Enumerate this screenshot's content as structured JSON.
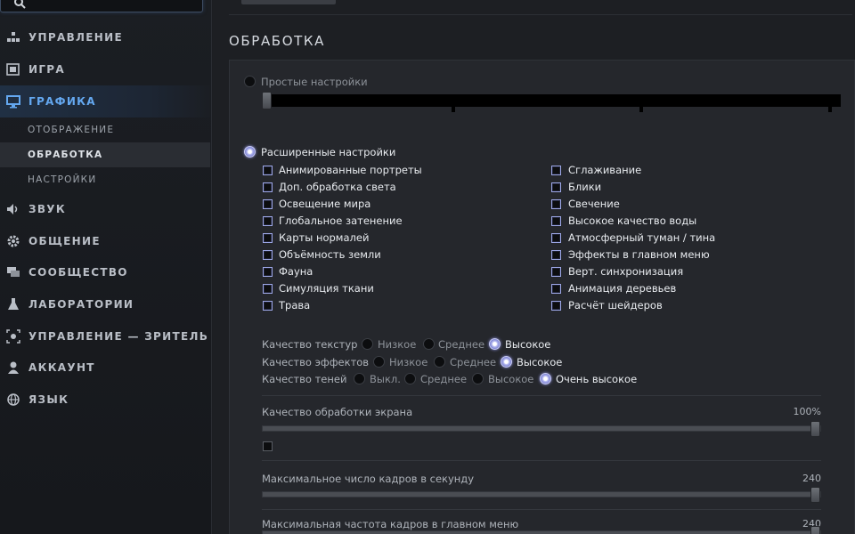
{
  "search": {
    "placeholder": ""
  },
  "sidebar": {
    "items": [
      {
        "label": "УПРАВЛЕНИЕ",
        "icon": "controls-icon"
      },
      {
        "label": "ИГРА",
        "icon": "game-icon"
      },
      {
        "label": "ГРАФИКА",
        "icon": "monitor-icon"
      },
      {
        "label": "ЗВУК",
        "icon": "speaker-icon"
      },
      {
        "label": "ОБЩЕНИЕ",
        "icon": "gear-icon"
      },
      {
        "label": "СООБЩЕСТВО",
        "icon": "chat-icon"
      },
      {
        "label": "ЛАБОРАТОРИИ",
        "icon": "flask-icon"
      },
      {
        "label": "УПРАВЛЕНИЕ — ЗРИТЕЛЬ",
        "icon": "spectator-icon"
      },
      {
        "label": "АККАУНТ",
        "icon": "user-icon"
      },
      {
        "label": "ЯЗЫК",
        "icon": "globe-icon"
      }
    ],
    "graphics_sub": [
      "ОТОБРАЖЕНИЕ",
      "ОБРАБОТКА",
      "НАСТРОЙКИ"
    ],
    "active_item": "ГРАФИКА",
    "active_sub": "ОБРАБОТКА"
  },
  "main": {
    "section_title": "ОБРАБОТКА",
    "simple_label": "Простые настройки",
    "advanced_label": "Расширенные настройки",
    "checkboxes_left": [
      "Анимированные портреты",
      "Доп. обработка света",
      "Освещение мира",
      "Глобальное затенение",
      "Карты нормалей",
      "Объёмность земли",
      "Фауна",
      "Симуляция ткани",
      "Трава"
    ],
    "checkboxes_right": [
      "Сглаживание",
      "Блики",
      "Свечение",
      "Высокое качество воды",
      "Атмосферный туман / тина",
      "Эффекты в главном меню",
      "Верт. синхронизация",
      "Анимация деревьев",
      "Расчёт шейдеров"
    ],
    "texture_quality": {
      "label": "Качество текстур",
      "options": [
        "Низкое",
        "Среднее",
        "Высокое"
      ],
      "selected": "Высокое"
    },
    "effects_quality": {
      "label": "Качество эффектов",
      "options": [
        "Низкое",
        "Среднее",
        "Высокое"
      ],
      "selected": "Высокое"
    },
    "shadow_quality": {
      "label": "Качество теней",
      "options": [
        "Выкл.",
        "Среднее",
        "Высокое",
        "Очень высокое"
      ],
      "selected": "Очень высокое"
    },
    "screen_render": {
      "label": "Качество обработки экрана",
      "value": "100%",
      "level": 1.0
    },
    "max_fps": {
      "label": "Максимальное число кадров в секунду",
      "value": "240",
      "level": 1.0
    },
    "menu_fps": {
      "label": "Максимальная частота кадров в главном меню",
      "value": "240",
      "level": 1.0
    }
  },
  "colors": {
    "accent": "#64a8f0",
    "background": "#1d1f23",
    "panel": "#25272c"
  }
}
